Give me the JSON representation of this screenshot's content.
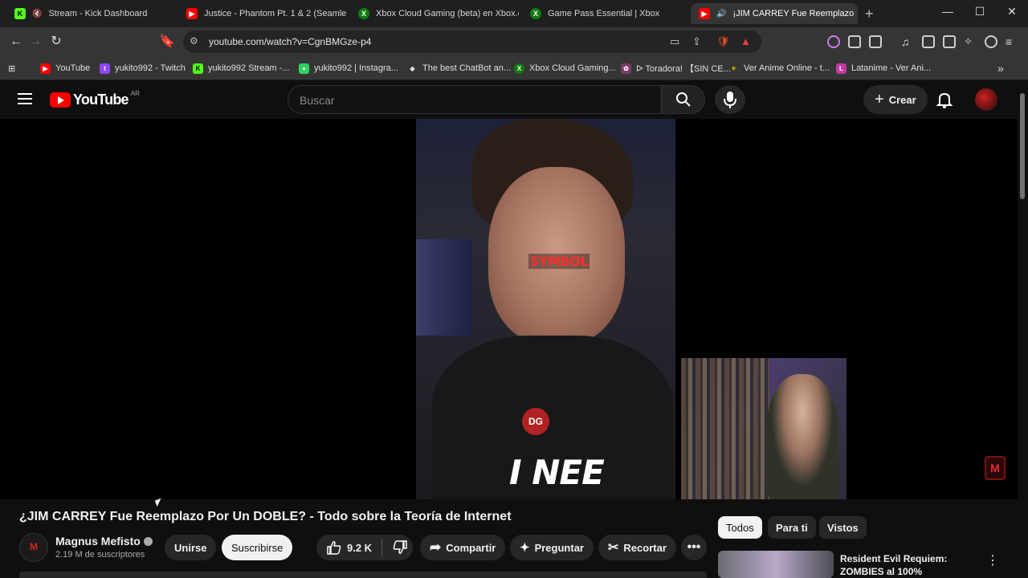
{
  "browser": {
    "tabs": [
      {
        "label": "Stream - Kick Dashboard",
        "fav": "K",
        "color": "#53fc18",
        "muted": true
      },
      {
        "label": "Justice - Phantom Pt. 1 & 2 (Seamle",
        "fav": "▶",
        "color": "#ff0000"
      },
      {
        "label": "Xbox Cloud Gaming (beta) en Xbox.c",
        "fav": "X",
        "color": "#107c10"
      },
      {
        "label": "Game Pass Essential | Xbox",
        "fav": "X",
        "color": "#107c10"
      },
      {
        "label": "¡JIM CARREY Fue Reemplazo",
        "fav": "▶",
        "color": "#ff0000"
      }
    ],
    "url": "youtube.com/watch?v=CgnBMGze-p4",
    "bookmarks": [
      {
        "label": "YouTube",
        "fav": "▶",
        "color": "#ff0000"
      },
      {
        "label": "yukito992 - Twitch",
        "fav": "t",
        "color": "#9146ff"
      },
      {
        "label": "yukito992 Stream -...",
        "fav": "K",
        "color": "#53fc18"
      },
      {
        "label": "yukito992 | Instagra...",
        "fav": "●",
        "color": "#2bd45c"
      },
      {
        "label": "The best ChatBot an...",
        "fav": "◆",
        "color": "#dddddd"
      },
      {
        "label": "Xbox Cloud Gaming...",
        "fav": "X",
        "color": "#107c10"
      },
      {
        "label": "ᐅ Toradora! 【SIN CE...",
        "fav": "✿",
        "color": "#7a3d6b"
      },
      {
        "label": "Ver Anime Online - t...",
        "fav": "✶",
        "color": "#e0a800"
      },
      {
        "label": "Latanime - Ver Ani...",
        "fav": "L",
        "color": "#c03aa0"
      }
    ]
  },
  "youtube": {
    "logo_text": "YouTube",
    "country": "AR",
    "search_placeholder": "Buscar",
    "create_label": "Crear"
  },
  "video": {
    "overlay_word": "SYMBOL",
    "shirt_logo": "DG",
    "caption": "I NEE",
    "badge": "M",
    "title": "¿JIM CARREY Fue Reemplazo Por Un DOBLE? - Todo sobre la Teoría de Internet"
  },
  "channel": {
    "name": "Magnus Mefisto",
    "subscribers": "2.19 M de suscriptores",
    "join_label": "Unirse",
    "subscribe_label": "Suscribirse"
  },
  "actions": {
    "likes": "9.2 K",
    "share": "Compartir",
    "ask": "Preguntar",
    "clip": "Recortar"
  },
  "chips": [
    "Todos",
    "Para ti",
    "Vistos"
  ],
  "recommendation": {
    "title": "Resident Evil Requiem: ZOMBIES al 100%"
  }
}
